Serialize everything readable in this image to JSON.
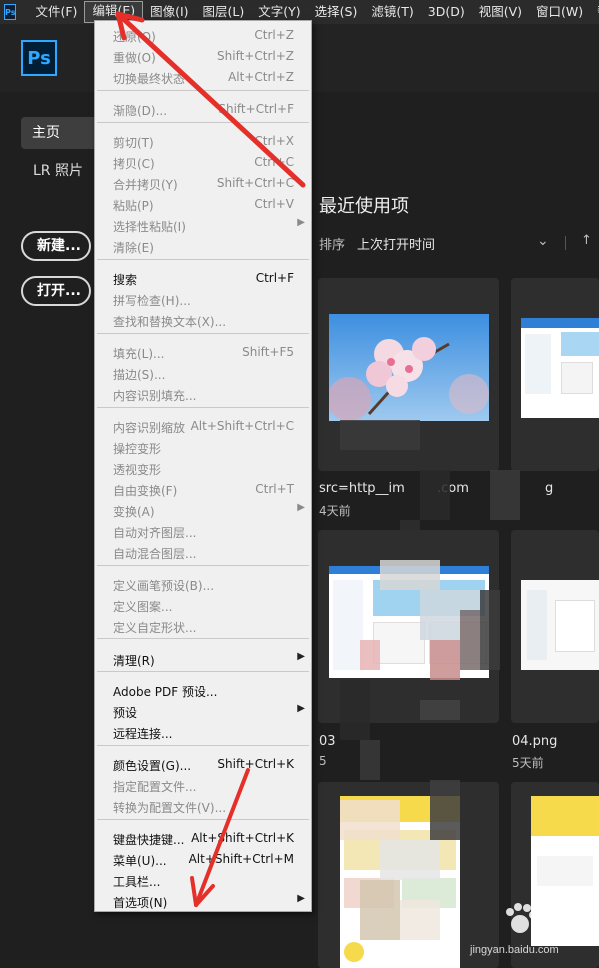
{
  "menubar": {
    "icon": "Ps",
    "items": [
      "文件(F)",
      "编辑(E)",
      "图像(I)",
      "图层(L)",
      "文字(Y)",
      "选择(S)",
      "滤镜(T)",
      "3D(D)",
      "视图(V)",
      "窗口(W)",
      "帮"
    ]
  },
  "header": {
    "logo": "Ps"
  },
  "sidebar": {
    "home": "主页",
    "lr": "LR 照片",
    "new_button": "新建...",
    "open_button": "打开..."
  },
  "recent": {
    "title": "最近使用项",
    "sort_label": "排序",
    "sort_value": "上次打开时间",
    "files": [
      {
        "name": "src=http__im",
        "name2": ".com",
        "age": "4天前"
      },
      {
        "name": "g",
        "age": ""
      },
      {
        "name": "03",
        "age": "5"
      },
      {
        "name": "04.png",
        "age": "5天前"
      }
    ]
  },
  "edit_menu": {
    "items": [
      {
        "label": "还原(O)",
        "shortcut": "Ctrl+Z",
        "enabled": false
      },
      {
        "label": "重做(O)",
        "shortcut": "Shift+Ctrl+Z",
        "enabled": false
      },
      {
        "label": "切换最终状态",
        "shortcut": "Alt+Ctrl+Z",
        "enabled": false
      },
      {
        "label": "渐隐(D)...",
        "shortcut": "Shift+Ctrl+F",
        "enabled": false
      },
      {
        "label": "剪切(T)",
        "shortcut": "Ctrl+X",
        "enabled": false
      },
      {
        "label": "拷贝(C)",
        "shortcut": "Ctrl+C",
        "enabled": false
      },
      {
        "label": "合并拷贝(Y)",
        "shortcut": "Shift+Ctrl+C",
        "enabled": false
      },
      {
        "label": "粘贴(P)",
        "shortcut": "Ctrl+V",
        "enabled": false
      },
      {
        "label": "选择性粘贴(I)",
        "shortcut": "",
        "enabled": false,
        "submenu": true
      },
      {
        "label": "清除(E)",
        "shortcut": "",
        "enabled": false
      },
      {
        "label": "搜索",
        "shortcut": "Ctrl+F",
        "enabled": true
      },
      {
        "label": "拼写检查(H)...",
        "shortcut": "",
        "enabled": false
      },
      {
        "label": "查找和替换文本(X)...",
        "shortcut": "",
        "enabled": false
      },
      {
        "label": "填充(L)...",
        "shortcut": "Shift+F5",
        "enabled": false
      },
      {
        "label": "描边(S)...",
        "shortcut": "",
        "enabled": false
      },
      {
        "label": "内容识别填充...",
        "shortcut": "",
        "enabled": false
      },
      {
        "label": "内容识别缩放",
        "shortcut": "Alt+Shift+Ctrl+C",
        "enabled": false
      },
      {
        "label": "操控变形",
        "shortcut": "",
        "enabled": false
      },
      {
        "label": "透视变形",
        "shortcut": "",
        "enabled": false
      },
      {
        "label": "自由变换(F)",
        "shortcut": "Ctrl+T",
        "enabled": false
      },
      {
        "label": "变换(A)",
        "shortcut": "",
        "enabled": false,
        "submenu": true
      },
      {
        "label": "自动对齐图层...",
        "shortcut": "",
        "enabled": false
      },
      {
        "label": "自动混合图层...",
        "shortcut": "",
        "enabled": false
      },
      {
        "label": "定义画笔预设(B)...",
        "shortcut": "",
        "enabled": false
      },
      {
        "label": "定义图案...",
        "shortcut": "",
        "enabled": false
      },
      {
        "label": "定义自定形状...",
        "shortcut": "",
        "enabled": false
      },
      {
        "label": "清理(R)",
        "shortcut": "",
        "enabled": true,
        "submenu": true
      },
      {
        "label": "Adobe PDF 预设...",
        "shortcut": "",
        "enabled": true
      },
      {
        "label": "预设",
        "shortcut": "",
        "enabled": true,
        "submenu": true
      },
      {
        "label": "远程连接...",
        "shortcut": "",
        "enabled": true
      },
      {
        "label": "颜色设置(G)...",
        "shortcut": "Shift+Ctrl+K",
        "enabled": true
      },
      {
        "label": "指定配置文件...",
        "shortcut": "",
        "enabled": false
      },
      {
        "label": "转换为配置文件(V)...",
        "shortcut": "",
        "enabled": false
      },
      {
        "label": "键盘快捷键...",
        "shortcut": "Alt+Shift+Ctrl+K",
        "enabled": true
      },
      {
        "label": "菜单(U)...",
        "shortcut": "Alt+Shift+Ctrl+M",
        "enabled": true
      },
      {
        "label": "工具栏...",
        "shortcut": "",
        "enabled": true
      },
      {
        "label": "首选项(N)",
        "shortcut": "",
        "enabled": true,
        "submenu": true
      }
    ]
  },
  "watermark": {
    "text": "Bai",
    "site": "jingyan.baidu.com"
  },
  "colors": {
    "accent": "#31a8ff",
    "annotation": "#e5302a"
  }
}
